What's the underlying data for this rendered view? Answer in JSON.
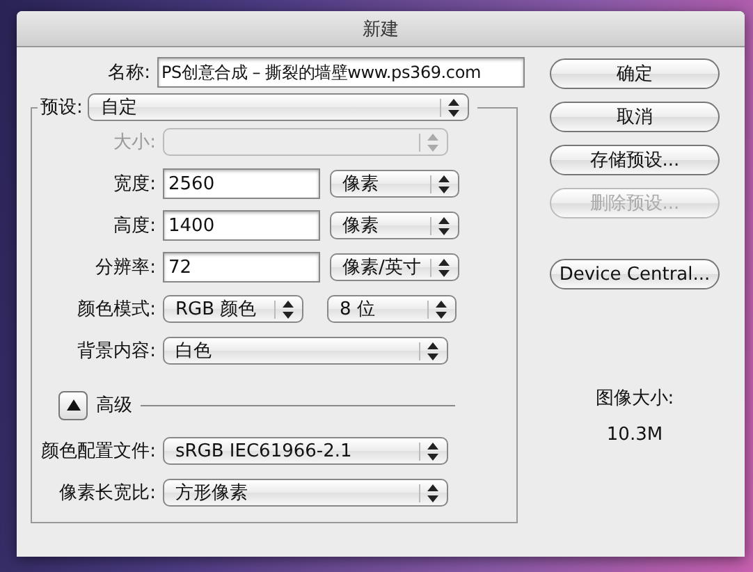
{
  "window": {
    "title": "新建"
  },
  "name": {
    "label": "名称:",
    "value": "PS创意合成 – 撕裂的墙壁www.ps369.com"
  },
  "preset": {
    "label": "预设:",
    "value": "自定"
  },
  "rows": [
    {
      "kind": "select",
      "label": "大小:",
      "disabled": true
    },
    {
      "kind": "input_unit",
      "label": "宽度:",
      "value": "2560",
      "unit": "像素",
      "disabled": false
    },
    {
      "kind": "input_unit",
      "label": "高度:",
      "value": "1400",
      "unit": "像素",
      "disabled": false
    },
    {
      "kind": "input_unit",
      "label": "分辨率:",
      "value": "72",
      "unit": "像素/英寸",
      "disabled": false
    },
    {
      "kind": "double_select",
      "label": "颜色模式:",
      "value": "RGB 颜色",
      "unit": "8 位",
      "disabled": false
    },
    {
      "kind": "select",
      "label": "背景内容:",
      "value": "白色",
      "disabled": false
    }
  ],
  "advanced": {
    "label": "高级",
    "expanded": true
  },
  "advanced_rows": [
    {
      "label": "颜色配置文件:",
      "value": "sRGB IEC61966-2.1"
    },
    {
      "label": "像素长宽比:",
      "value": "方形像素"
    }
  ],
  "buttons": [
    {
      "label": "确定",
      "disabled": false
    },
    {
      "label": "取消",
      "disabled": false
    },
    {
      "label": "存储预设...",
      "disabled": false
    },
    {
      "label": "删除预设...",
      "disabled": true
    },
    {
      "label": "Device Central...",
      "disabled": false
    }
  ],
  "image_size": {
    "label": "图像大小:",
    "value": "10.3M"
  }
}
